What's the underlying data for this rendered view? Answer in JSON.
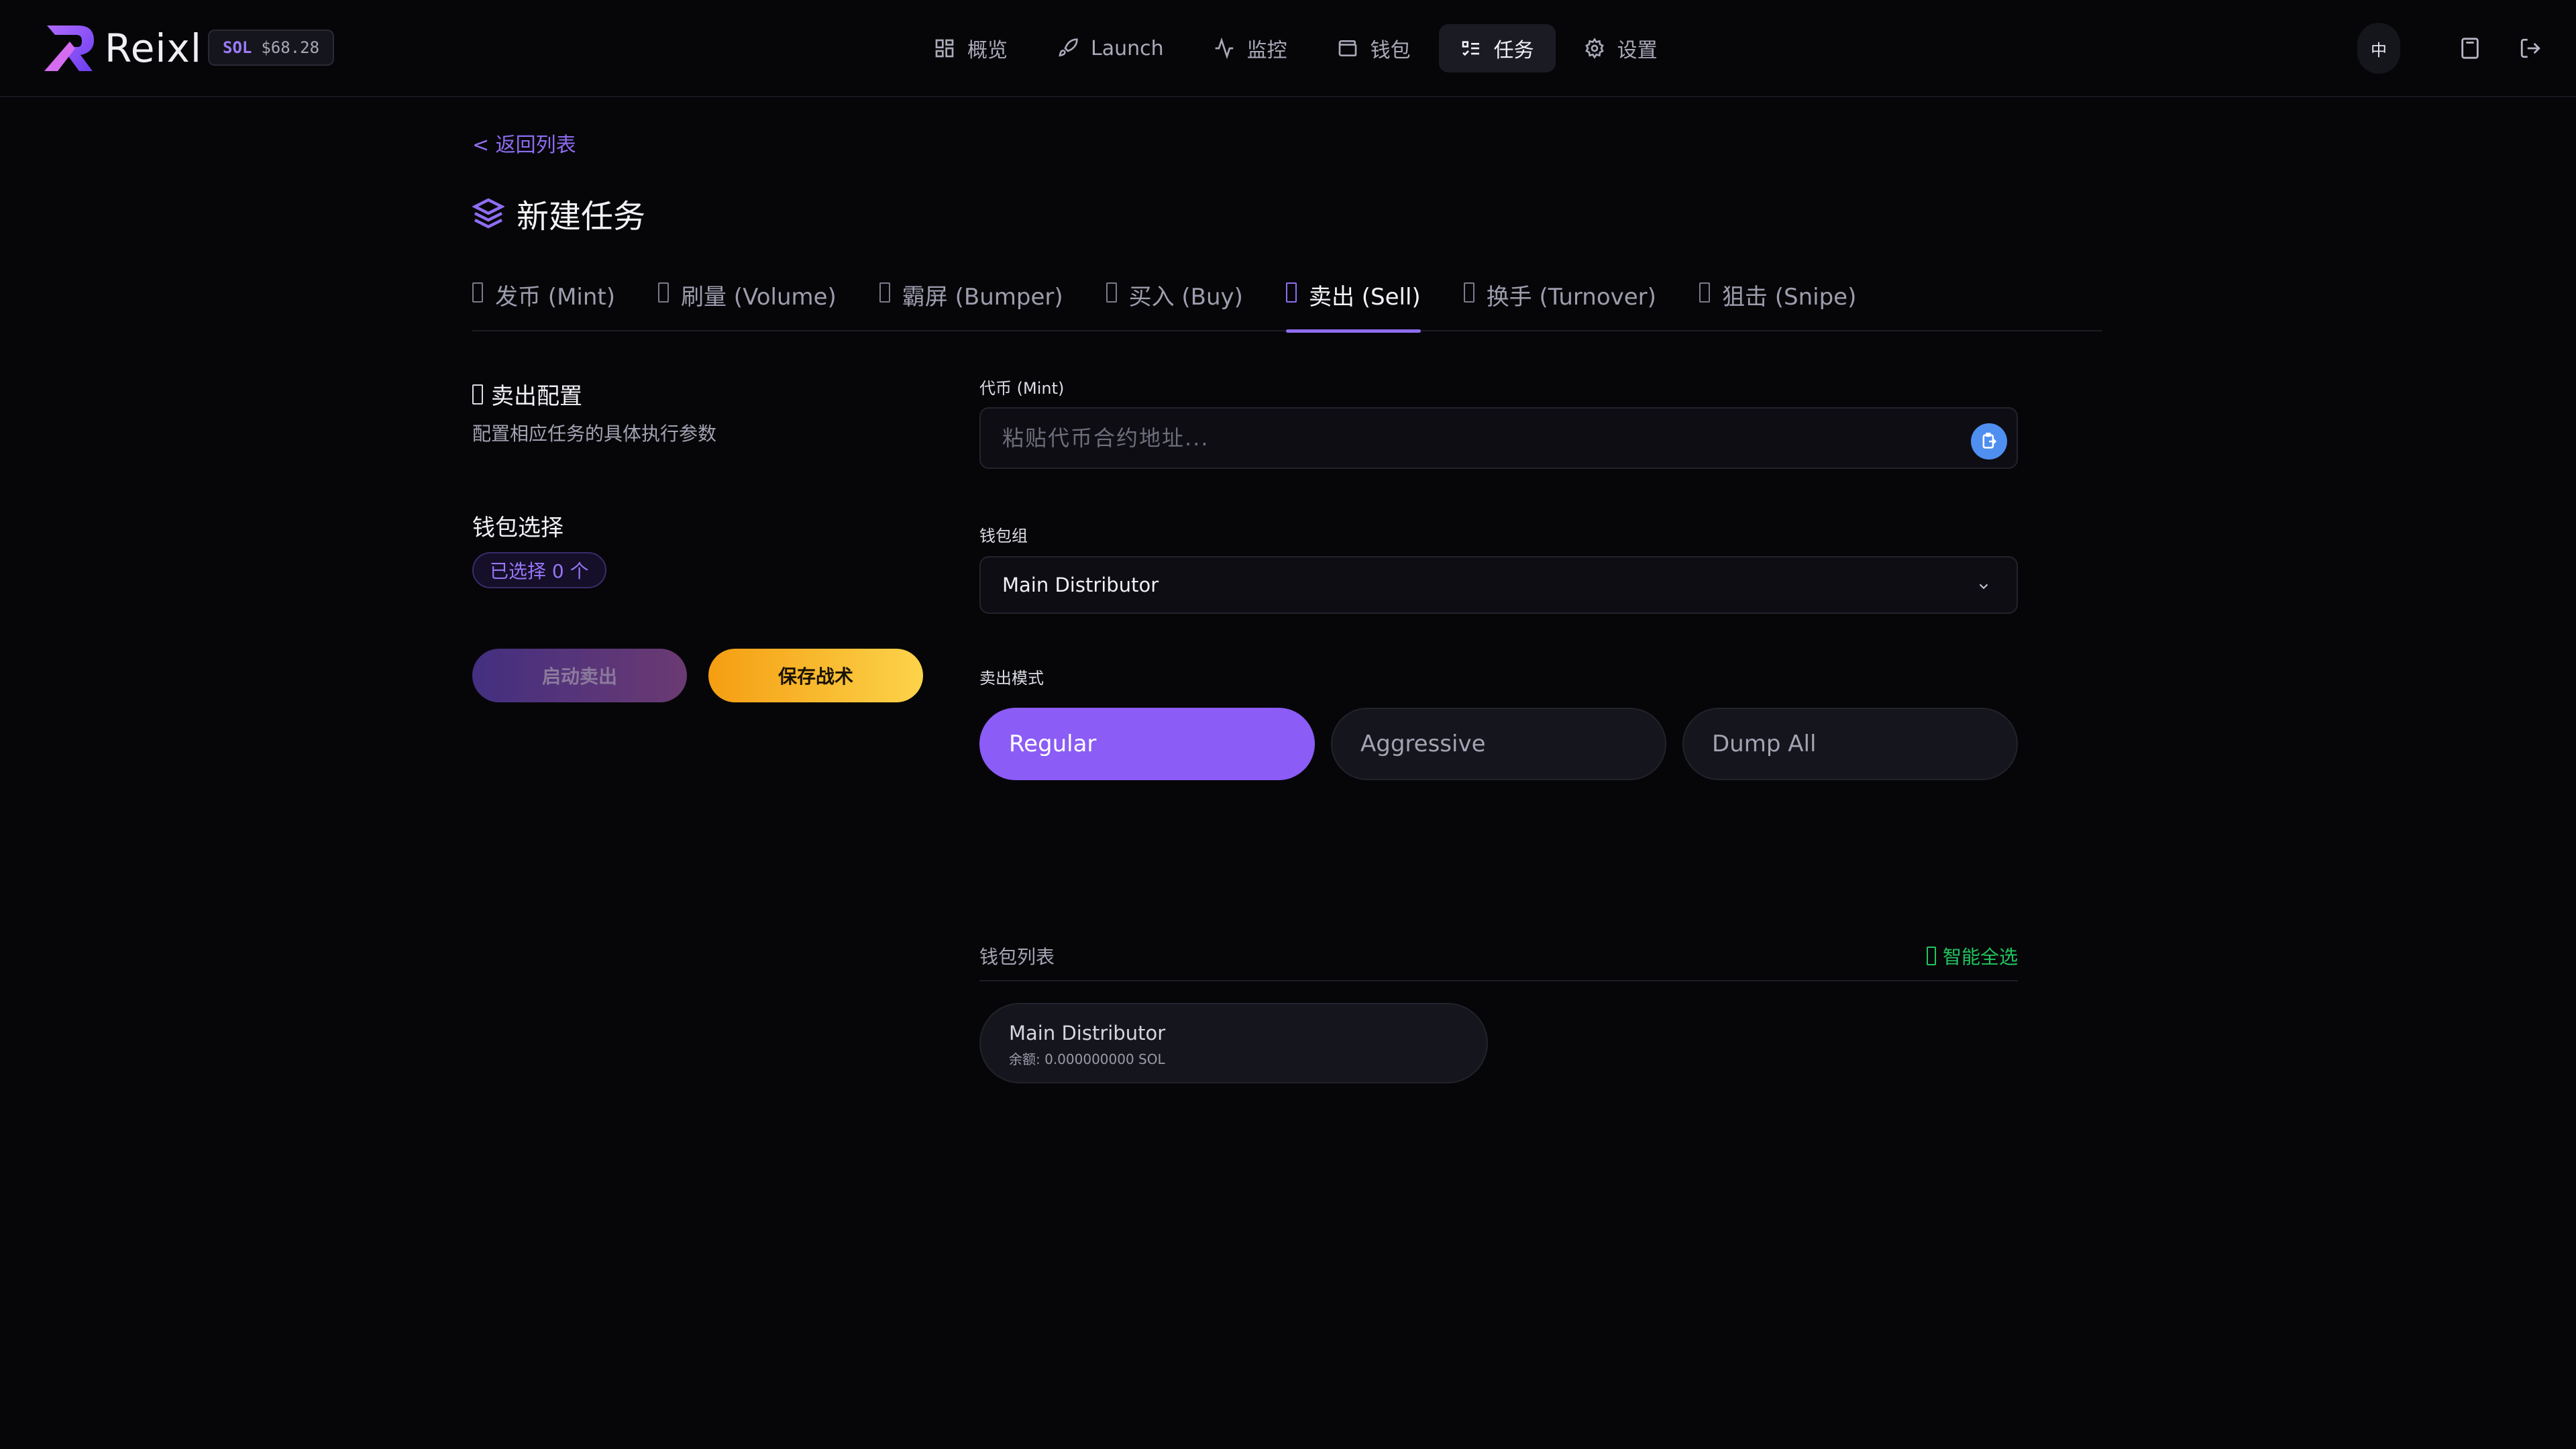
{
  "brand": {
    "name": "Reixl"
  },
  "sol_badge": {
    "symbol": "SOL",
    "price": "$68.28"
  },
  "nav": [
    {
      "label": "概览",
      "icon": "grid-icon"
    },
    {
      "label": "Launch",
      "icon": "rocket-icon"
    },
    {
      "label": "监控",
      "icon": "activity-icon"
    },
    {
      "label": "钱包",
      "icon": "wallet-icon"
    },
    {
      "label": "任务",
      "icon": "list-check-icon",
      "active": true
    },
    {
      "label": "设置",
      "icon": "gear-icon"
    }
  ],
  "header_right": {
    "lang": "中",
    "calculator_icon": "calculator-icon",
    "logout_icon": "logout-icon"
  },
  "back_link": "< 返回列表",
  "page_title": "新建任务",
  "tabs": [
    {
      "label": "发币 (Mint)"
    },
    {
      "label": "刷量 (Volume)"
    },
    {
      "label": "霸屏 (Bumper)"
    },
    {
      "label": "买入 (Buy)"
    },
    {
      "label": "卖出 (Sell)",
      "active": true
    },
    {
      "label": "换手 (Turnover)"
    },
    {
      "label": "狙击 (Snipe)"
    }
  ],
  "config": {
    "title": "卖出配置",
    "description": "配置相应任务的具体执行参数"
  },
  "wallet_selection": {
    "title": "钱包选择",
    "selected_badge": "已选择 0 个"
  },
  "actions": {
    "start_label": "启动卖出",
    "save_label": "保存战术"
  },
  "form": {
    "mint_label": "代币 (Mint)",
    "mint_value": "",
    "mint_placeholder": "粘贴代币合约地址...",
    "wallet_group_label": "钱包组",
    "wallet_group_value": "Main Distributor",
    "sell_mode_label": "卖出模式",
    "modes": [
      {
        "label": "Regular",
        "active": true
      },
      {
        "label": "Aggressive"
      },
      {
        "label": "Dump All"
      }
    ]
  },
  "wallet_list": {
    "title": "钱包列表",
    "smart_select": "智能全选",
    "items": [
      {
        "name": "Main Distributor",
        "balance": "余额: 0.000000000 SOL"
      }
    ]
  },
  "colors": {
    "accent": "#8b5cf6",
    "save": "#f59e12",
    "smart_select": "#22c55e",
    "paste": "#4f8ff0"
  }
}
